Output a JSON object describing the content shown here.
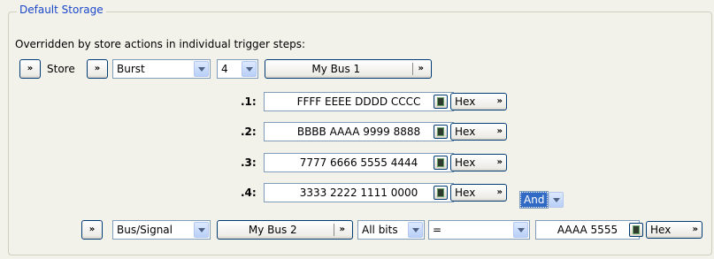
{
  "group_title": "Default Storage",
  "note": "Overridden by store actions in individual trigger steps:",
  "store_row": {
    "label": "Store",
    "mode": "Burst",
    "count": "4",
    "bus": "My Bus 1"
  },
  "values": [
    {
      "index": ".1:",
      "value": "FFFF EEEE DDDD CCCC",
      "format": "Hex"
    },
    {
      "index": ".2:",
      "value": "BBBB AAAA 9999 8888",
      "format": "Hex"
    },
    {
      "index": ".3:",
      "value": "7777 6666 5555 4444",
      "format": "Hex"
    },
    {
      "index": ".4:",
      "value": "3333 2222 1111 0000",
      "format": "Hex"
    }
  ],
  "logic": "And",
  "bus_row": {
    "type": "Bus/Signal",
    "bus": "My Bus 2",
    "bits": "All bits",
    "operator": "=",
    "value": "AAAA 5555",
    "format": "Hex"
  },
  "icons": {
    "expand": "double-chevron-down-icon",
    "calculator": "calculator-icon",
    "dropdown": "dropdown-arrow-icon"
  },
  "colors": {
    "background": "#f2f1ea",
    "group_title": "#1a47c8",
    "selection": "#316ac5",
    "button_border": "#003c74",
    "field_border": "#7f9db9"
  }
}
